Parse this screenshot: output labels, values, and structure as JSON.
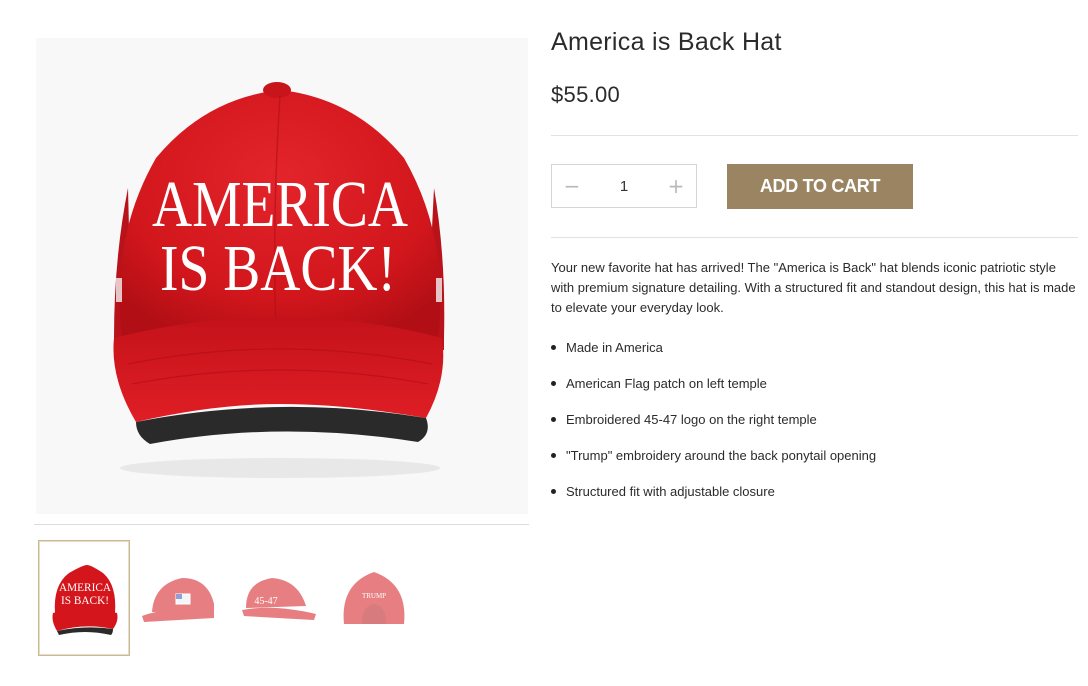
{
  "product": {
    "title": "America is Back Hat",
    "price": "$55.00",
    "quantity": "1",
    "add_to_cart_label": "ADD TO CART",
    "minus_symbol": "−",
    "plus_symbol": "+",
    "description": "Your new favorite hat has arrived! The \"America is Back\" hat blends iconic patriotic style with premium signature detailing. With a structured fit and standout design, this hat is made to elevate your everyday look.",
    "features": [
      "Made in America",
      "American Flag patch on left temple",
      "Embroidered 45-47 logo on the right temple",
      "\"Trump\" embroidery around the back ponytail opening",
      "Structured fit with adjustable closure"
    ]
  },
  "gallery": {
    "main_embroidery": [
      "AMERICA",
      "IS BACK!"
    ],
    "thumb_embroidery": {
      "front": [
        "AMERICA",
        "IS BACK!"
      ],
      "right": "45-47",
      "back": "TRUMP"
    },
    "thumbnails": [
      {
        "view": "front",
        "active": true
      },
      {
        "view": "left-side",
        "active": false
      },
      {
        "view": "right-side",
        "active": false
      },
      {
        "view": "back",
        "active": false
      }
    ]
  },
  "colors": {
    "accent_button": "#9b8461",
    "hat_red": "#d4161c",
    "active_thumb_border": "#c8b896",
    "divider": "#e2e2e2"
  },
  "icons": {
    "minus": "minus-icon",
    "plus": "plus-icon"
  }
}
